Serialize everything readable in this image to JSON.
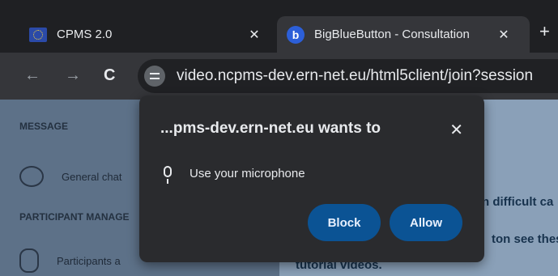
{
  "tabs": [
    {
      "title": "CPMS 2.0",
      "favicon": "eu-flag-icon",
      "close": "✕"
    },
    {
      "title": "BigBlueButton - Consultation",
      "favicon": "bigbluebutton-icon",
      "favicon_letter": "b",
      "close": "✕"
    }
  ],
  "new_tab": "+",
  "toolbar": {
    "back": "←",
    "forward": "→",
    "reload": "C",
    "url": "video.ncpms-dev.ern-net.eu/html5client/join?session"
  },
  "sidebar": {
    "message_heading": "MESSAGE",
    "general_chat": "General chat",
    "participant_heading": "PARTICIPANT MANAGE",
    "participants": "Participants a"
  },
  "content": {
    "line1": "n difficult ca",
    "line2": "ton see thes",
    "line3": "tutorial videos."
  },
  "permission_dialog": {
    "title": "...pms-dev.ern-net.eu wants to",
    "close": "✕",
    "permission": "Use your microphone",
    "block_label": "Block",
    "allow_label": "Allow"
  },
  "colors": {
    "dialog_bg": "#2a2b2e",
    "button_bg": "#0b5394",
    "tab_active": "#35363a"
  }
}
